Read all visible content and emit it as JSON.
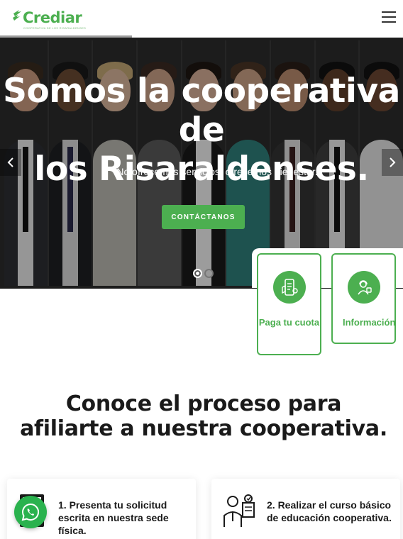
{
  "header": {
    "logo_text": "Crediar",
    "logo_tagline": "COOPERATIVA DE LOS RISARALDENSES",
    "menu_icon": "hamburger-menu-icon"
  },
  "hero": {
    "title_line1": "Somos la cooperativa de",
    "title_line2": "los Risaraldenses.",
    "subtitle": "No ofrecemos servicios, ofrecemos bienestar.",
    "cta_label": "CONTÁCTANOS",
    "prev_icon": "chevron-left-icon",
    "next_icon": "chevron-right-icon",
    "slides_total": 2,
    "active_slide": 1
  },
  "quick_actions": [
    {
      "label": "Paga tu cuota",
      "icon": "payment-phone-icon"
    },
    {
      "label": "Información",
      "icon": "customer-service-icon"
    }
  ],
  "section": {
    "title_line1": "Conoce el proceso para",
    "title_line2": "afiliarte a nuestra cooperativa."
  },
  "steps": [
    {
      "text": "1. Presenta tu solicitud escrita en nuestra sede física.",
      "icon": "document-icon"
    },
    {
      "text": "2. Realizar el curso básico de educación cooperativa.",
      "icon": "teacher-board-icon"
    }
  ],
  "floating": {
    "icon": "whatsapp-icon"
  },
  "colors": {
    "brand_green": "#4caf50",
    "whatsapp_green": "#2ab24e",
    "dark_text": "#1a1a1a"
  }
}
